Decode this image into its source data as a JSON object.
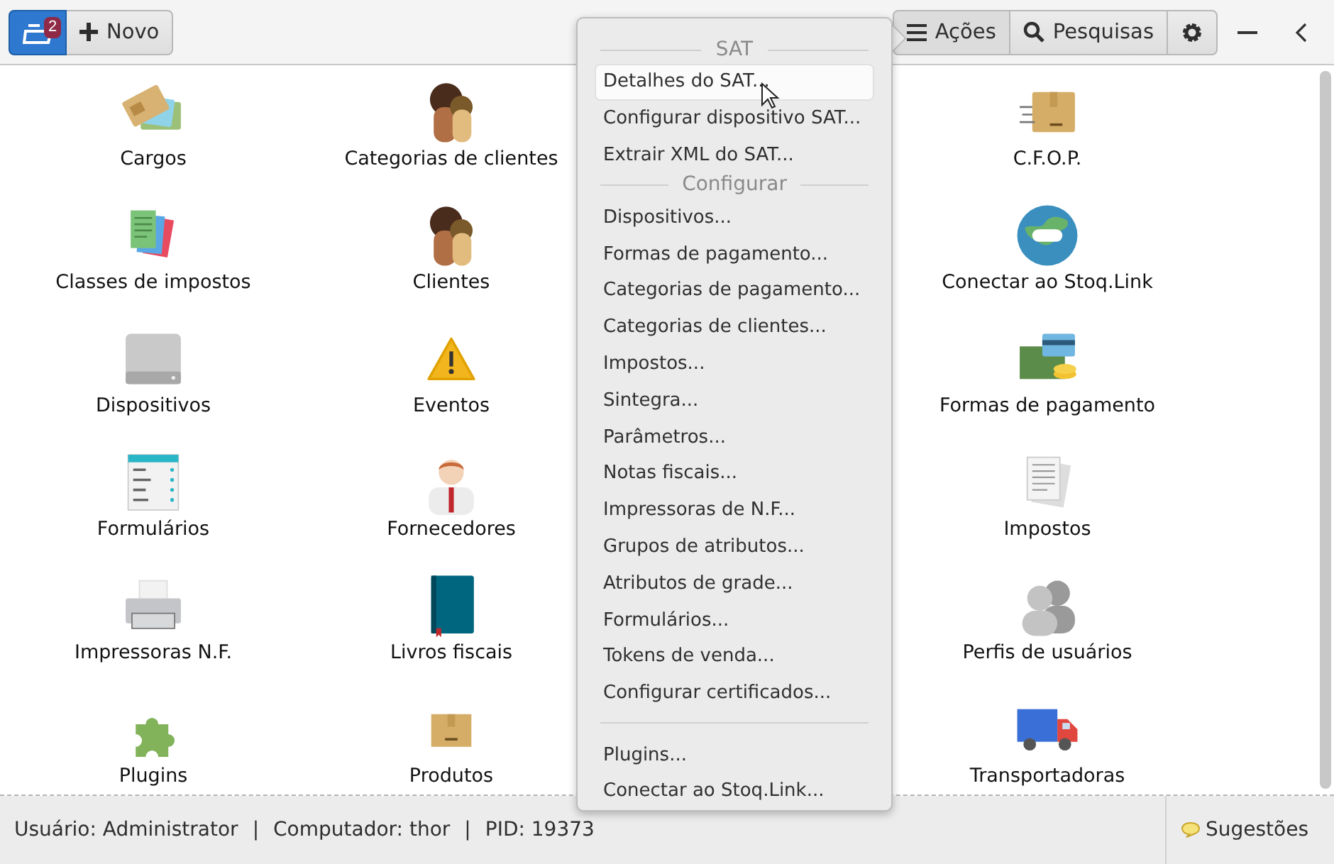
{
  "header": {
    "app_badge": "2",
    "new_button": "Novo",
    "actions_button": {
      "label": "Ações",
      "selected": true
    },
    "search_button": "Pesquisas"
  },
  "tiles": [
    {
      "items": [
        "Cargos",
        "Categorias de clientes",
        "C.F.O.P."
      ]
    },
    {
      "items": [
        "Classes de impostos",
        "Clientes",
        "Conectar ao Stoq.Link"
      ]
    },
    {
      "items": [
        "Dispositivos",
        "Eventos",
        "Formas de pagamento"
      ]
    },
    {
      "items": [
        "Formulários",
        "Fornecedores",
        "Impostos"
      ]
    },
    {
      "items": [
        "Impressoras N.F.",
        "Livros fiscais",
        "Perfis de usuários"
      ]
    },
    {
      "items": [
        "Plugins",
        "Produtos",
        "Transportadoras"
      ]
    }
  ],
  "menu": {
    "sections": [
      {
        "title": "SAT",
        "items": [
          {
            "label": "Detalhes do SAT...",
            "selected": true
          },
          {
            "label": "Configurar dispositivo SAT...",
            "selected": false
          },
          {
            "label": "Extrair XML do SAT...",
            "selected": false
          }
        ]
      },
      {
        "title": "Configurar",
        "items": [
          {
            "label": "Dispositivos...",
            "selected": false
          },
          {
            "label": "Formas de pagamento...",
            "selected": false
          },
          {
            "label": "Categorias de pagamento...",
            "selected": false
          },
          {
            "label": "Categorias de clientes...",
            "selected": false
          },
          {
            "label": "Impostos...",
            "selected": false
          },
          {
            "label": "Sintegra...",
            "selected": false
          },
          {
            "label": "Parâmetros...",
            "selected": false
          },
          {
            "label": "Notas fiscais...",
            "selected": false
          },
          {
            "label": "Impressoras de N.F...",
            "selected": false
          },
          {
            "label": "Grupos de atributos...",
            "selected": false
          },
          {
            "label": "Atributos de grade...",
            "selected": false
          },
          {
            "label": "Formulários...",
            "selected": false
          },
          {
            "label": "Tokens de venda...",
            "selected": false
          },
          {
            "label": "Configurar certificados...",
            "selected": false
          }
        ]
      },
      {
        "items": [
          {
            "label": "Plugins...",
            "selected": false
          },
          {
            "label": "Conectar ao Stoq.Link...",
            "selected": false
          }
        ]
      }
    ]
  },
  "status_bar": {
    "info": [
      "Usuário: Administrator",
      "Computador: thor",
      "PID: 19373"
    ],
    "separator": "|",
    "suggestions": "Sugestões"
  }
}
